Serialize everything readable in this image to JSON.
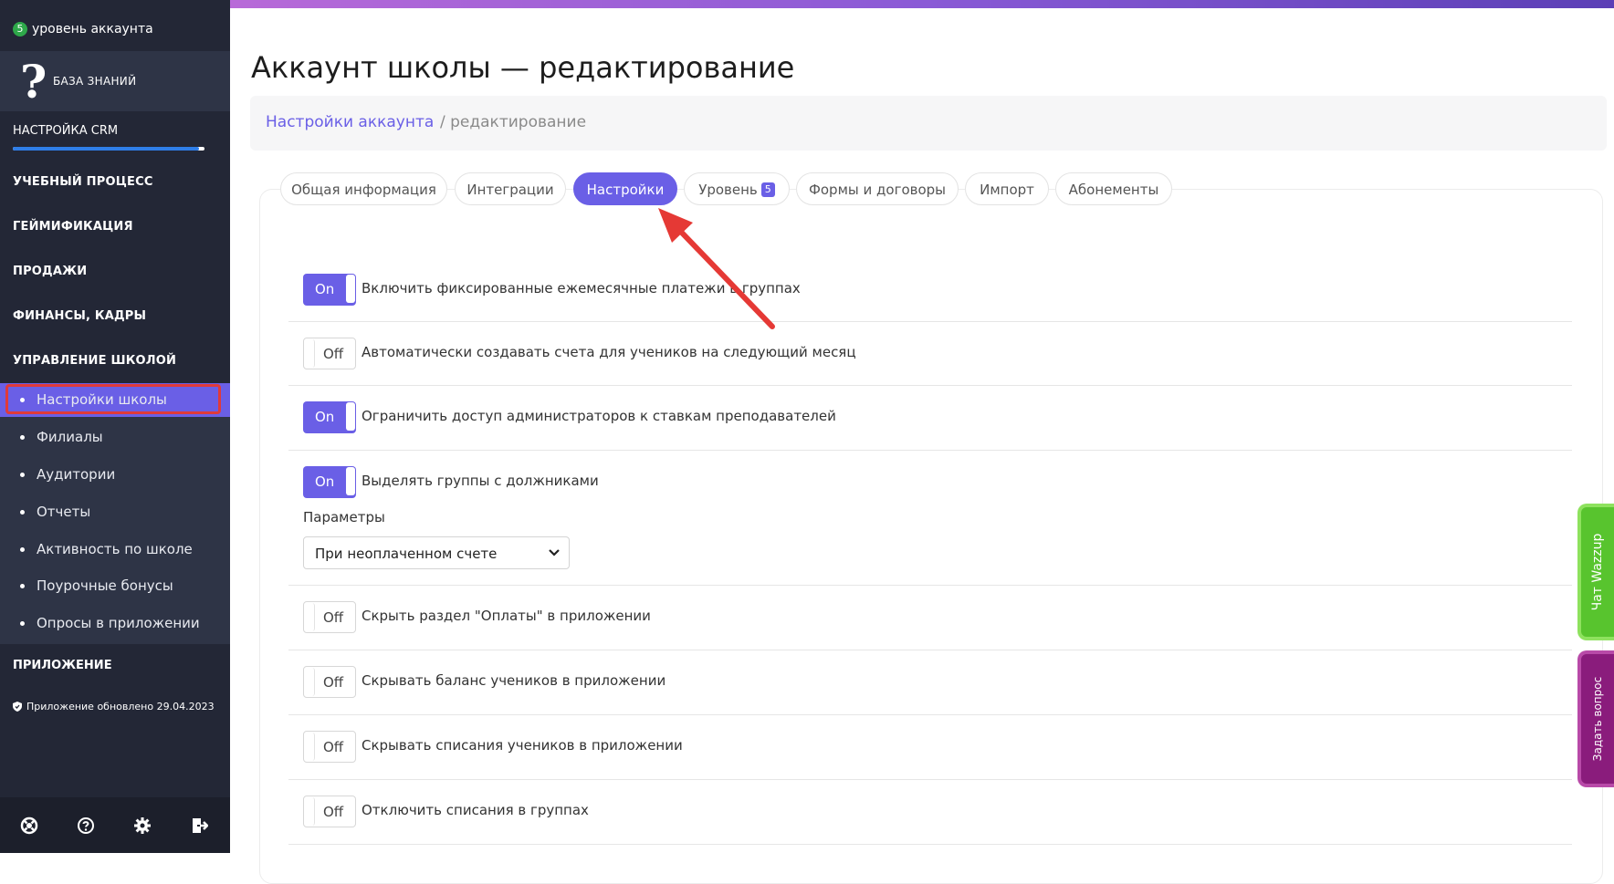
{
  "sidebar": {
    "level_badge": "5",
    "level_label": "уровень аккаунта",
    "knowledge_base": "БАЗА ЗНАНИЙ",
    "crm_setup": "НАСТРОЙКА CRM",
    "crm_progress": 0.97,
    "sections": {
      "study": "УЧЕБНЫЙ ПРОЦЕСС",
      "gamification": "ГЕЙМИФИКАЦИЯ",
      "sales": "ПРОДАЖИ",
      "finance": "ФИНАНСЫ, КАДРЫ",
      "school_mgmt": "УПРАВЛЕНИЕ ШКОЛОЙ"
    },
    "items": [
      {
        "label": "Настройки школы"
      },
      {
        "label": "Филиалы"
      },
      {
        "label": "Аудитории"
      },
      {
        "label": "Отчеты"
      },
      {
        "label": "Активность по школе"
      },
      {
        "label": "Поурочные бонусы"
      },
      {
        "label": "Опросы в приложении"
      }
    ],
    "app_section": "ПРИЛОЖЕНИЕ",
    "app_updated": "Приложение обновлено 29.04.2023"
  },
  "page": {
    "title": "Аккаунт школы — редактирование",
    "breadcrumb_link": "Настройки аккаунта",
    "breadcrumb_current": "/ редактирование"
  },
  "tabs": [
    {
      "label": "Общая информация"
    },
    {
      "label": "Интеграции"
    },
    {
      "label": "Настройки"
    },
    {
      "label": "Уровень",
      "badge": "5"
    },
    {
      "label": "Формы и договоры"
    },
    {
      "label": "Импорт"
    },
    {
      "label": "Абонементы"
    }
  ],
  "settings": [
    {
      "state": "On",
      "text": "Включить фиксированные ежемесячные платежи в группах"
    },
    {
      "state": "Off",
      "text": "Автоматически создавать счета для учеников на следующий месяц"
    },
    {
      "state": "On",
      "text": "Ограничить доступ администраторов к ставкам преподавателей"
    },
    {
      "state": "On",
      "text": "Выделять группы с должниками"
    },
    {
      "state": "Off",
      "text": "Скрыть раздел \"Оплаты\" в приложении"
    },
    {
      "state": "Off",
      "text": "Скрывать баланс учеников в приложении"
    },
    {
      "state": "Off",
      "text": "Скрывать списания учеников в приложении"
    },
    {
      "state": "Off",
      "text": "Отключить списания в группах"
    }
  ],
  "params": {
    "label": "Параметры",
    "selected": "При неоплаченном счете"
  },
  "floating": {
    "chat": "Чат Wazzup",
    "ask": "Задать вопрос"
  },
  "colors": {
    "accent": "#6a5fe6",
    "sidebar_bg": "#232736",
    "highlight": "#e03a3a",
    "chat_green": "#58c42e",
    "ask_purple": "#8a1c7c"
  }
}
